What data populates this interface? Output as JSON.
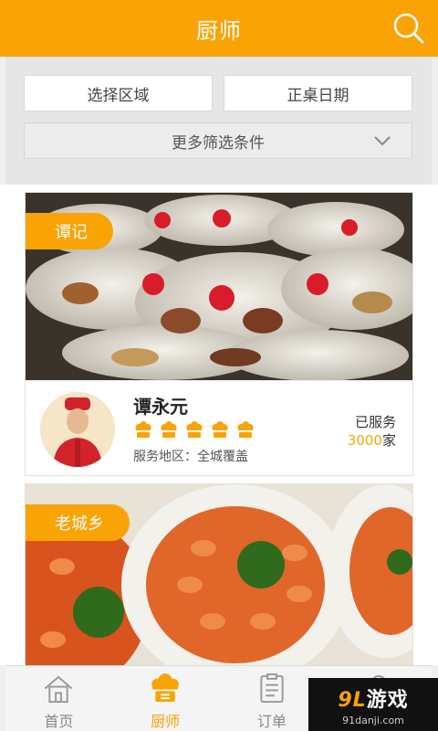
{
  "header": {
    "title": "厨师",
    "search_icon": "search-icon"
  },
  "filters": {
    "region_label": "选择区域",
    "date_label": "正桌日期",
    "more_label": "更多筛选条件"
  },
  "cards": [
    {
      "tag": "谭记",
      "image": "banquet-dishes-photo",
      "chef_name": "谭永元",
      "rating": 5,
      "area": "服务地区：全城覆盖",
      "served_label": "已服务",
      "served_count": "3000",
      "served_unit": "家"
    },
    {
      "tag": "老城乡",
      "image": "shrimp-platter-photo"
    }
  ],
  "nav": {
    "items": [
      {
        "label": "首页",
        "icon": "home-icon",
        "active": false
      },
      {
        "label": "厨师",
        "icon": "chef-hat-icon",
        "active": true
      },
      {
        "label": "订单",
        "icon": "order-icon",
        "active": false
      },
      {
        "label": "",
        "icon": "profile-icon",
        "active": false
      }
    ]
  },
  "watermark": {
    "brand_num": "9",
    "brand_l": "L",
    "brand_text": "游戏",
    "domain": "91danji.com"
  },
  "colors": {
    "accent": "#f9a305",
    "header_bg": "#f9a305"
  }
}
